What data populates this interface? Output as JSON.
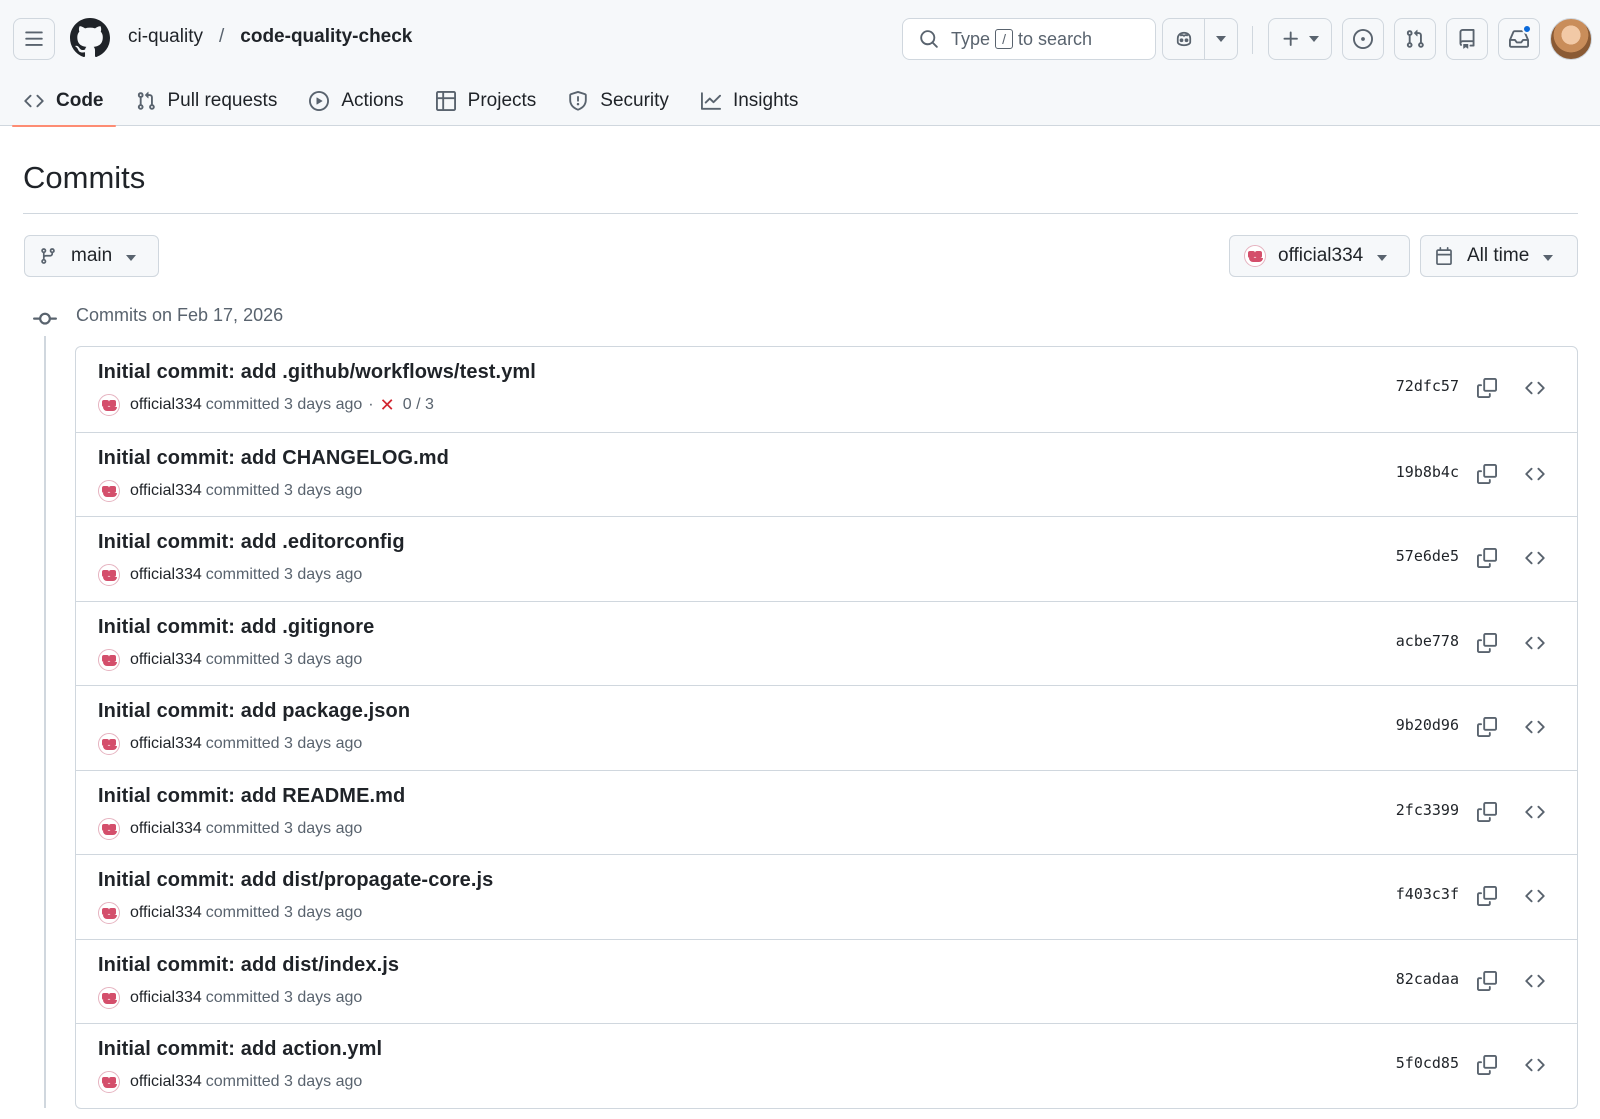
{
  "header": {
    "owner": "ci-quality",
    "separator": "/",
    "repo": "code-quality-check",
    "search": {
      "prefix": "Type",
      "key": "/",
      "suffix": "to search"
    }
  },
  "repo_nav": {
    "items": [
      {
        "label": "Code",
        "icon": "code-icon",
        "active": true
      },
      {
        "label": "Pull requests",
        "icon": "git-pull-request-icon"
      },
      {
        "label": "Actions",
        "icon": "play-icon"
      },
      {
        "label": "Projects",
        "icon": "table-icon"
      },
      {
        "label": "Security",
        "icon": "shield-icon"
      },
      {
        "label": "Insights",
        "icon": "graph-icon"
      }
    ]
  },
  "page": {
    "title": "Commits",
    "branch": "main",
    "author_filter": "official334",
    "time_filter": "All time",
    "group_date": "Commits on Feb 17, 2026"
  },
  "commits": [
    {
      "message": "Initial commit: add .github/workflows/test.yml",
      "author": "official334",
      "action": "committed",
      "time": "3 days ago",
      "status": "0 / 3",
      "sha": "72dfc57"
    },
    {
      "message": "Initial commit: add CHANGELOG.md",
      "author": "official334",
      "action": "committed",
      "time": "3 days ago",
      "sha": "19b8b4c"
    },
    {
      "message": "Initial commit: add .editorconfig",
      "author": "official334",
      "action": "committed",
      "time": "3 days ago",
      "sha": "57e6de5"
    },
    {
      "message": "Initial commit: add .gitignore",
      "author": "official334",
      "action": "committed",
      "time": "3 days ago",
      "sha": "acbe778"
    },
    {
      "message": "Initial commit: add package.json",
      "author": "official334",
      "action": "committed",
      "time": "3 days ago",
      "sha": "9b20d96"
    },
    {
      "message": "Initial commit: add README.md",
      "author": "official334",
      "action": "committed",
      "time": "3 days ago",
      "sha": "2fc3399"
    },
    {
      "message": "Initial commit: add dist/propagate-core.js",
      "author": "official334",
      "action": "committed",
      "time": "3 days ago",
      "sha": "f403c3f"
    },
    {
      "message": "Initial commit: add dist/index.js",
      "author": "official334",
      "action": "committed",
      "time": "3 days ago",
      "sha": "82cadaa"
    },
    {
      "message": "Initial commit: add action.yml",
      "author": "official334",
      "action": "committed",
      "time": "3 days ago",
      "sha": "5f0cd85"
    }
  ],
  "colors": {
    "accent_underline": "#fd8c73",
    "fail": "#d1242f",
    "notification": "#0969da"
  }
}
